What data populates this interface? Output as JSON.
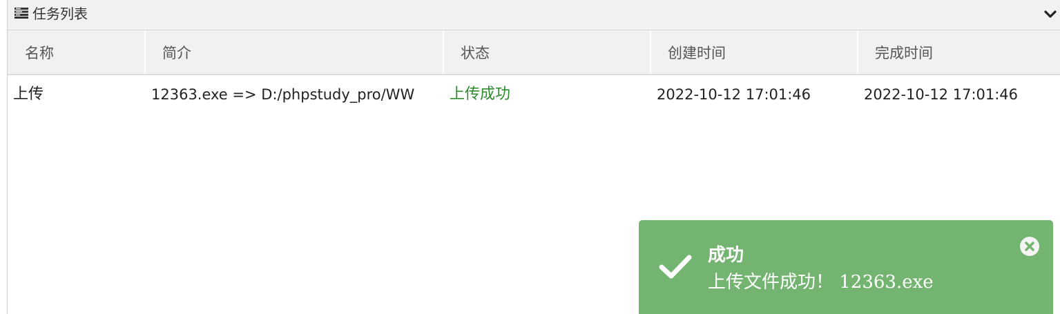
{
  "panel": {
    "title": "任务列表",
    "icons": {
      "title": "list-icon",
      "collapse": "chevron-down-icon"
    }
  },
  "table": {
    "columns": [
      "名称",
      "简介",
      "状态",
      "创建时间",
      "完成时间"
    ],
    "rows": [
      {
        "name": "上传",
        "description": "12363.exe => D:/phpstudy_pro/WW",
        "status": "上传成功",
        "created": "2022-10-12 17:01:46",
        "completed": "2022-10-12 17:01:46"
      }
    ]
  },
  "toast": {
    "title": "成功",
    "message": "上传文件成功！ 12363.exe",
    "icons": {
      "status": "check-icon",
      "close": "close-icon"
    }
  },
  "colors": {
    "status_success_text": "#2e8b2e",
    "toast_background": "#74b471",
    "header_background": "#f1f1f1"
  }
}
